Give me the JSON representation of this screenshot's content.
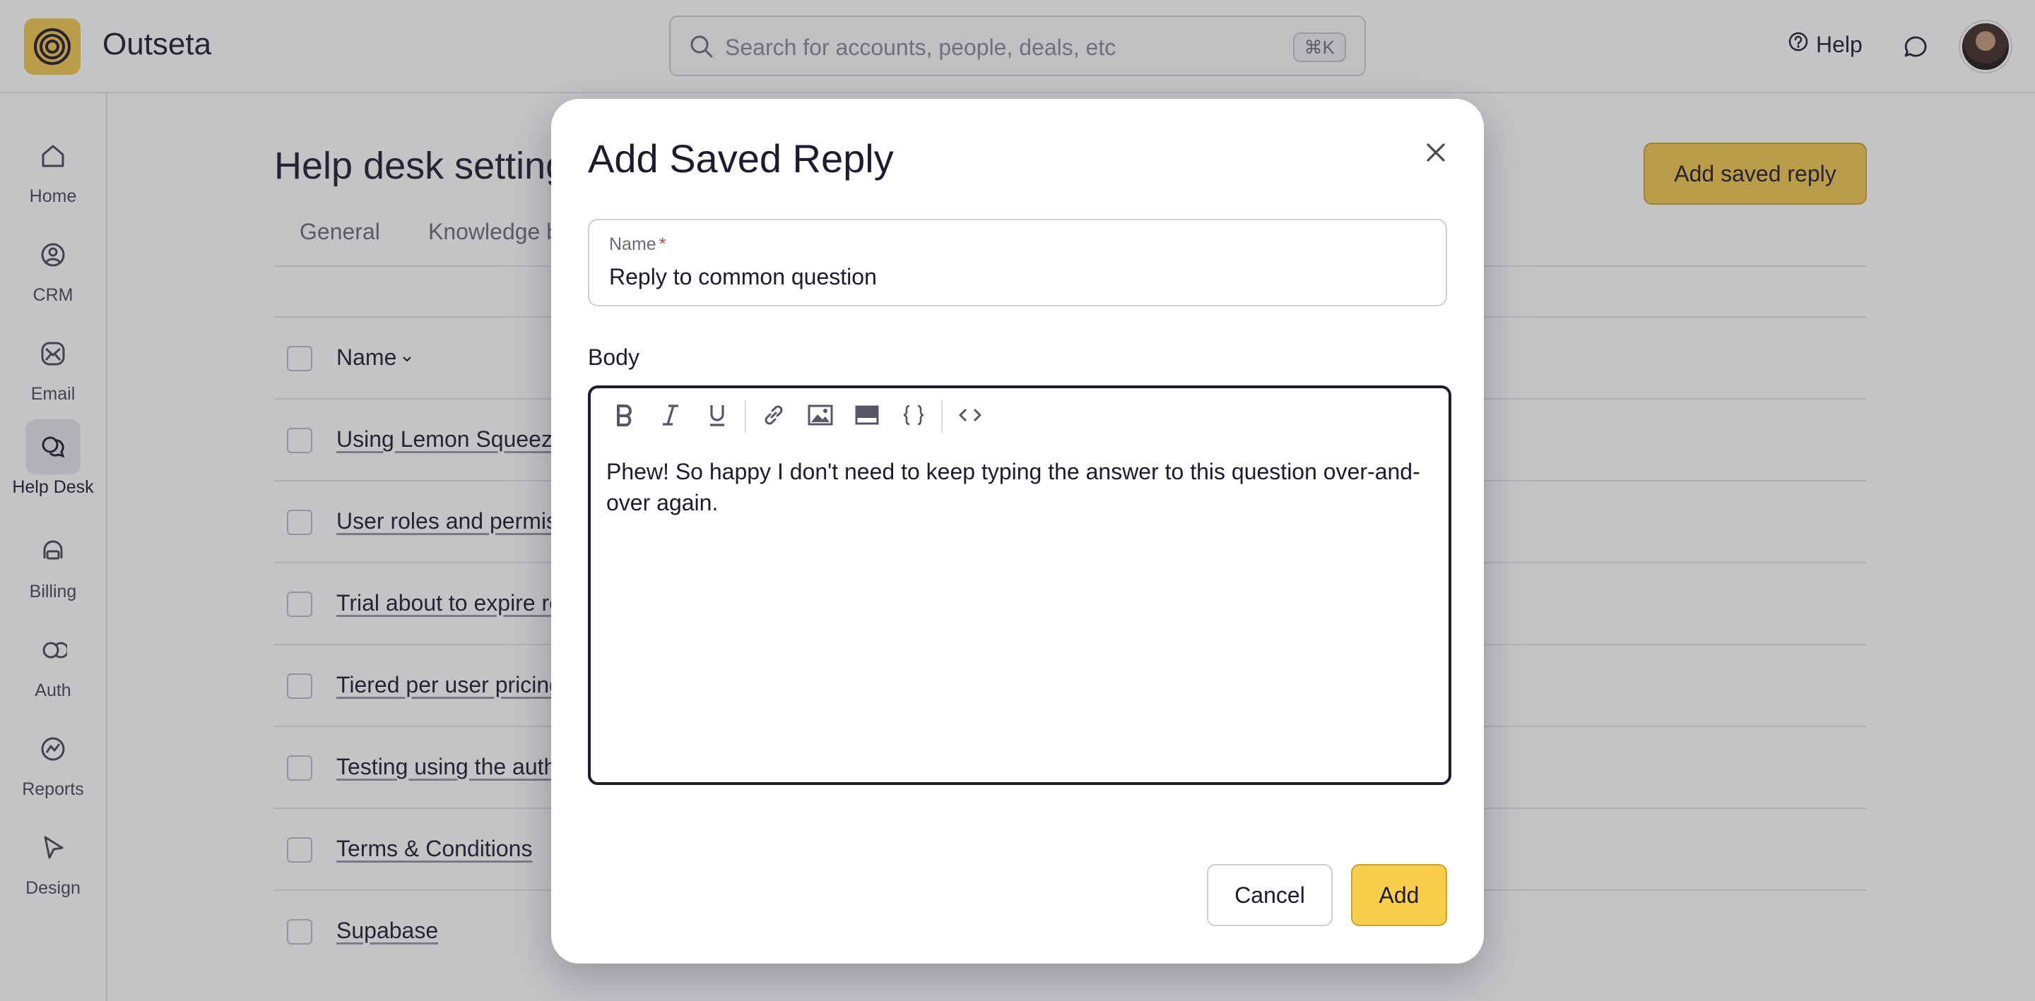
{
  "app": {
    "name": "Outseta",
    "colors": {
      "brand": "#f2c94c",
      "text": "#1f1a2e",
      "required": "#d93a3a"
    }
  },
  "header": {
    "search_placeholder": "Search for accounts, people, deals, etc",
    "search_shortcut": "⌘K",
    "help_label": "Help"
  },
  "sidebar": {
    "items": [
      {
        "label": "Home",
        "icon": "home-icon"
      },
      {
        "label": "CRM",
        "icon": "crm-icon"
      },
      {
        "label": "Email",
        "icon": "email-icon"
      },
      {
        "label": "Help Desk",
        "icon": "help-desk-icon",
        "active": true
      },
      {
        "label": "Billing",
        "icon": "billing-icon"
      },
      {
        "label": "Auth",
        "icon": "auth-icon"
      },
      {
        "label": "Reports",
        "icon": "reports-icon"
      },
      {
        "label": "Design",
        "icon": "design-icon"
      }
    ]
  },
  "main": {
    "title": "Help desk settings",
    "add_button": "Add saved reply",
    "tabs": [
      "General",
      "Knowledge base"
    ],
    "table": {
      "header": "Name",
      "rows": [
        "Using Lemon Squeezy",
        "User roles and permissions",
        "Trial about to expire reminder",
        "Tiered per user pricing",
        "Testing using the auth",
        "Terms & Conditions",
        "Supabase"
      ]
    }
  },
  "modal": {
    "title": "Add Saved Reply",
    "name_label": "Name",
    "required_mark": "*",
    "name_value": "Reply to common question",
    "body_label": "Body",
    "body_text": "Phew! So happy I don't need to keep typing the answer to this question over-and-over again.",
    "toolbar": [
      "bold-icon",
      "italic-icon",
      "underline-icon",
      "link-icon",
      "image-icon",
      "embed-icon",
      "template-variable-icon",
      "code-icon"
    ],
    "cancel_label": "Cancel",
    "add_label": "Add"
  }
}
